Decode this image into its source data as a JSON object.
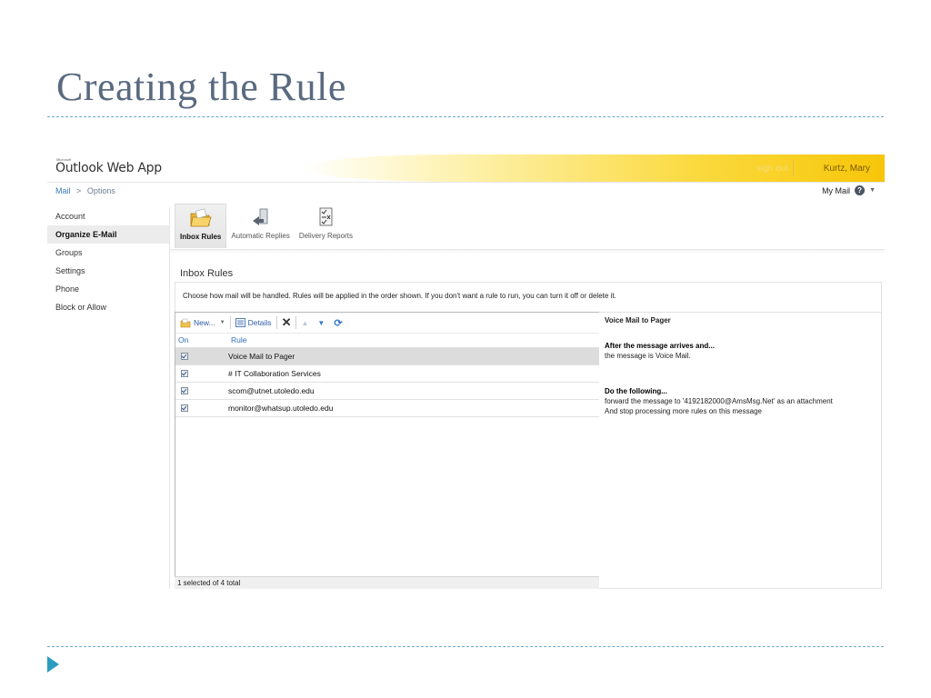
{
  "slide": {
    "title": "Creating the Rule"
  },
  "banner": {
    "logo_small": "Microsoft",
    "logo": "Outlook Web App",
    "sign_out": "sign out",
    "user": "Kurtz, Mary"
  },
  "breadcrumb": {
    "mail": "Mail",
    "separator": ">",
    "options": "Options"
  },
  "mymail": {
    "label": "My Mail"
  },
  "sidebar": {
    "items": [
      {
        "label": "Account"
      },
      {
        "label": "Organize E-Mail"
      },
      {
        "label": "Groups"
      },
      {
        "label": "Settings"
      },
      {
        "label": "Phone"
      },
      {
        "label": "Block or Allow"
      }
    ]
  },
  "tabs": [
    {
      "label": "Inbox Rules",
      "icon": "folder-icon"
    },
    {
      "label": "Automatic Replies",
      "icon": "reply-arrow-icon"
    },
    {
      "label": "Delivery Reports",
      "icon": "report-checklist-icon"
    }
  ],
  "main": {
    "section_title": "Inbox Rules",
    "description": "Choose how mail will be handled. Rules will be applied in the order shown. If you don't want a rule to run, you can turn it off or delete it."
  },
  "toolbar": {
    "new_label": "New...",
    "details_label": "Details"
  },
  "list": {
    "col_on": "On",
    "col_rule": "Rule",
    "rows": [
      {
        "name": "Voice Mail to Pager",
        "on": true,
        "selected": true
      },
      {
        "name": "# IT Collaboration Services",
        "on": true,
        "selected": false
      },
      {
        "name": "scom@utnet.utoledo.edu",
        "on": true,
        "selected": false
      },
      {
        "name": "monitor@whatsup.utoledo.edu",
        "on": true,
        "selected": false
      }
    ],
    "status": "1 selected of 4 total"
  },
  "details": {
    "title": "Voice Mail to Pager",
    "condition_header": "After the message arrives and...",
    "condition": "the message is Voice Mail.",
    "action_header": "Do the following...",
    "action_1": "forward the message to '4192182000@AmsMsg.Net' as an attachment",
    "action_2": "And stop processing more rules on this message"
  }
}
